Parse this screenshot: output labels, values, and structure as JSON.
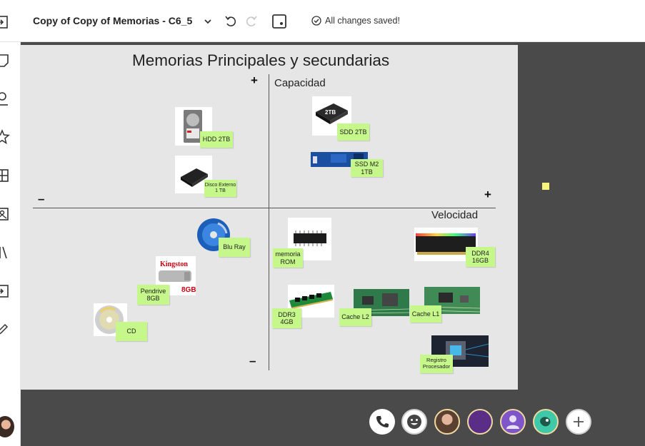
{
  "toolbar": {
    "doc_title": "Copy of Copy of Memorias - C6_5",
    "saved_status": "All changes saved!",
    "icons": [
      "chevron-down-icon",
      "undo-icon",
      "redo-icon",
      "frame-icon",
      "check-circle-icon"
    ]
  },
  "sidebar": {
    "icons": [
      "sign-in-icon",
      "sticky-note-icon",
      "search-person-icon",
      "star-icon",
      "grid-icon",
      "image-icon",
      "library-icon",
      "import-icon",
      "pen-icon"
    ]
  },
  "board": {
    "title": "Memorias Principales y secundarias",
    "y_axis_label": "Capacidad",
    "x_axis_label": "Velocidad",
    "plus_top": "+",
    "plus_right": "+",
    "minus_left": "–",
    "minus_bottom": "–",
    "items": [
      {
        "label": "HDD 2TB"
      },
      {
        "label": "Disco Externo 1 TB"
      },
      {
        "label": "SDD 2TB"
      },
      {
        "label": "SSD M2 1TB"
      },
      {
        "label": "Blu Ray"
      },
      {
        "label": "Pendrive 8GB"
      },
      {
        "label": "CD"
      },
      {
        "label": "memoria ROM"
      },
      {
        "label": "DDR4 16GB"
      },
      {
        "label": "DDR3 4GB"
      },
      {
        "label": "Cache L2"
      },
      {
        "label": "Cache L1"
      },
      {
        "label": "Registro Procesador"
      }
    ],
    "image_text": {
      "kingston": "Kingston",
      "pendrive_size": "8GB",
      "ssd_size": "2TB"
    }
  },
  "colors": {
    "sticky": "#c6f78a",
    "board": "#e6e6e6",
    "canvas": "#4a4a4a",
    "accent_yellow": "#f6f47c"
  },
  "call_tray": {
    "buttons": [
      "phone-icon",
      "smiley-icon",
      "participant-avatar",
      "participant-avatar",
      "participant-avatar",
      "participant-avatar",
      "add-icon"
    ]
  }
}
